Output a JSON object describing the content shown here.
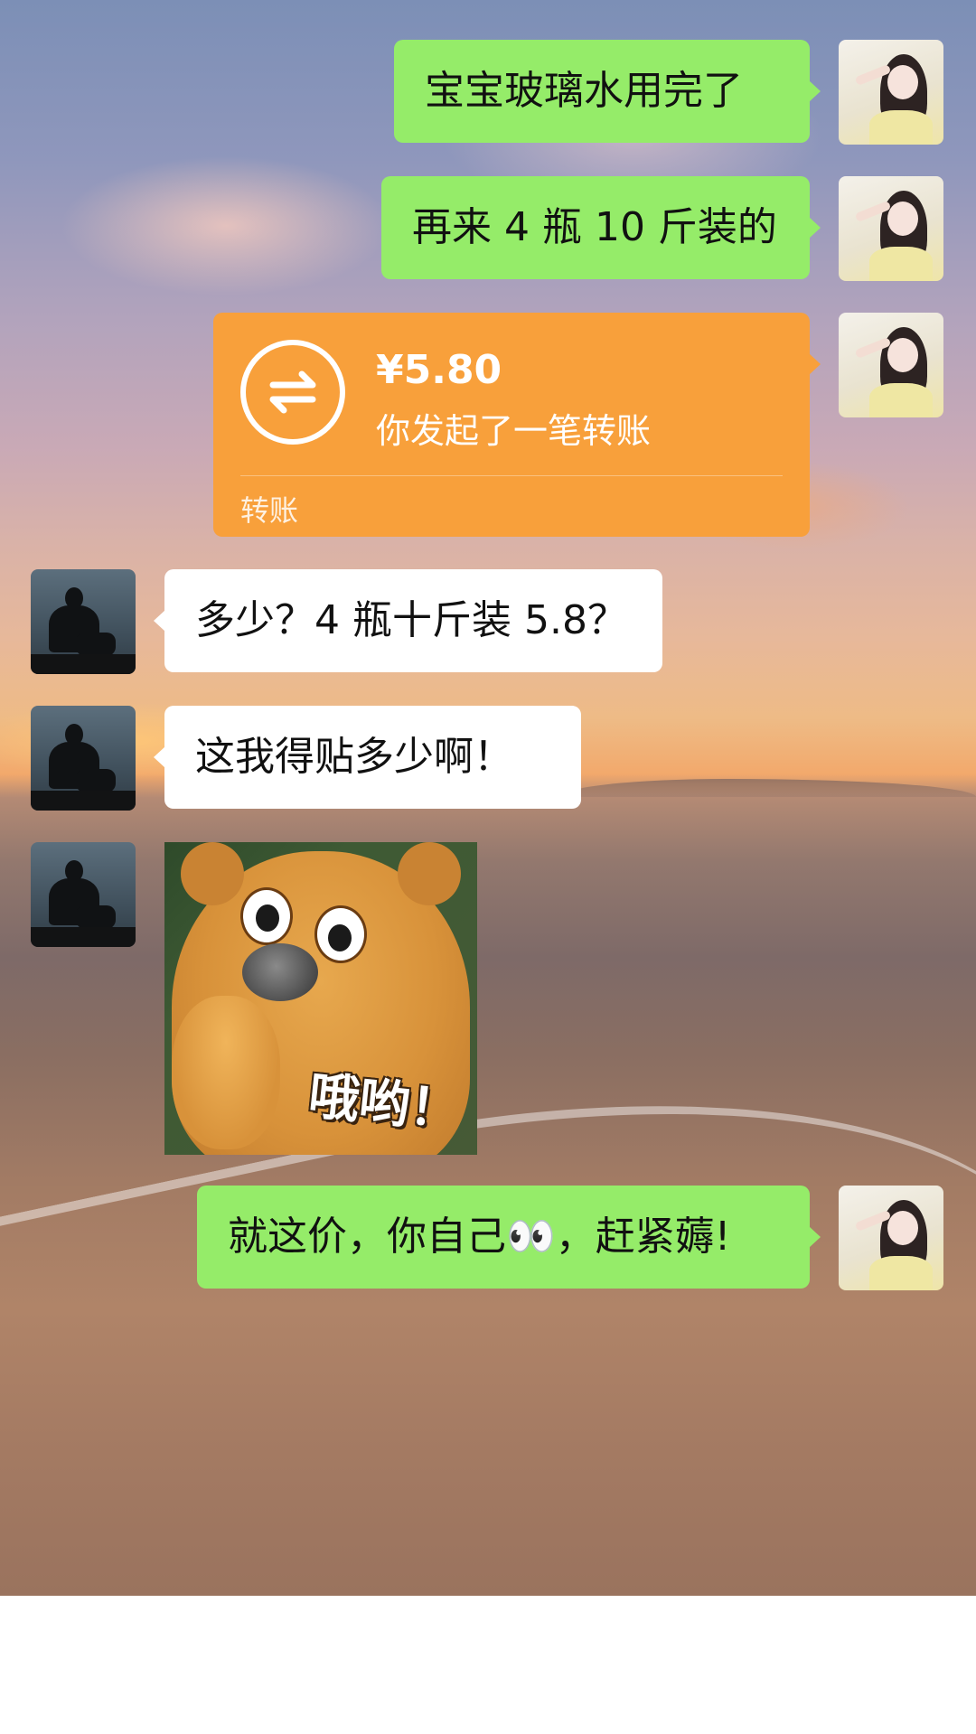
{
  "chat": {
    "messages": [
      {
        "side": "right",
        "text": "宝宝玻璃水用完了"
      },
      {
        "side": "right",
        "text": "再来 4 瓶 10 斤装的"
      },
      {
        "side": "left",
        "text": "多少？4 瓶十斤装 5.8？"
      },
      {
        "side": "left",
        "text": "这我得贴多少啊！"
      },
      {
        "side": "right",
        "text": "就这价，你自己👀，赶紧薅!"
      }
    ],
    "transfer": {
      "amount": "¥5.80",
      "description": "你发起了一笔转账",
      "label": "转账"
    },
    "sticker": {
      "caption": "哦哟！"
    }
  },
  "colors": {
    "sent_bubble": "#95ec69",
    "received_bubble": "#ffffff",
    "transfer_card": "#f8a03b"
  },
  "icons": {
    "transfer": "transfer-arrows-icon"
  }
}
